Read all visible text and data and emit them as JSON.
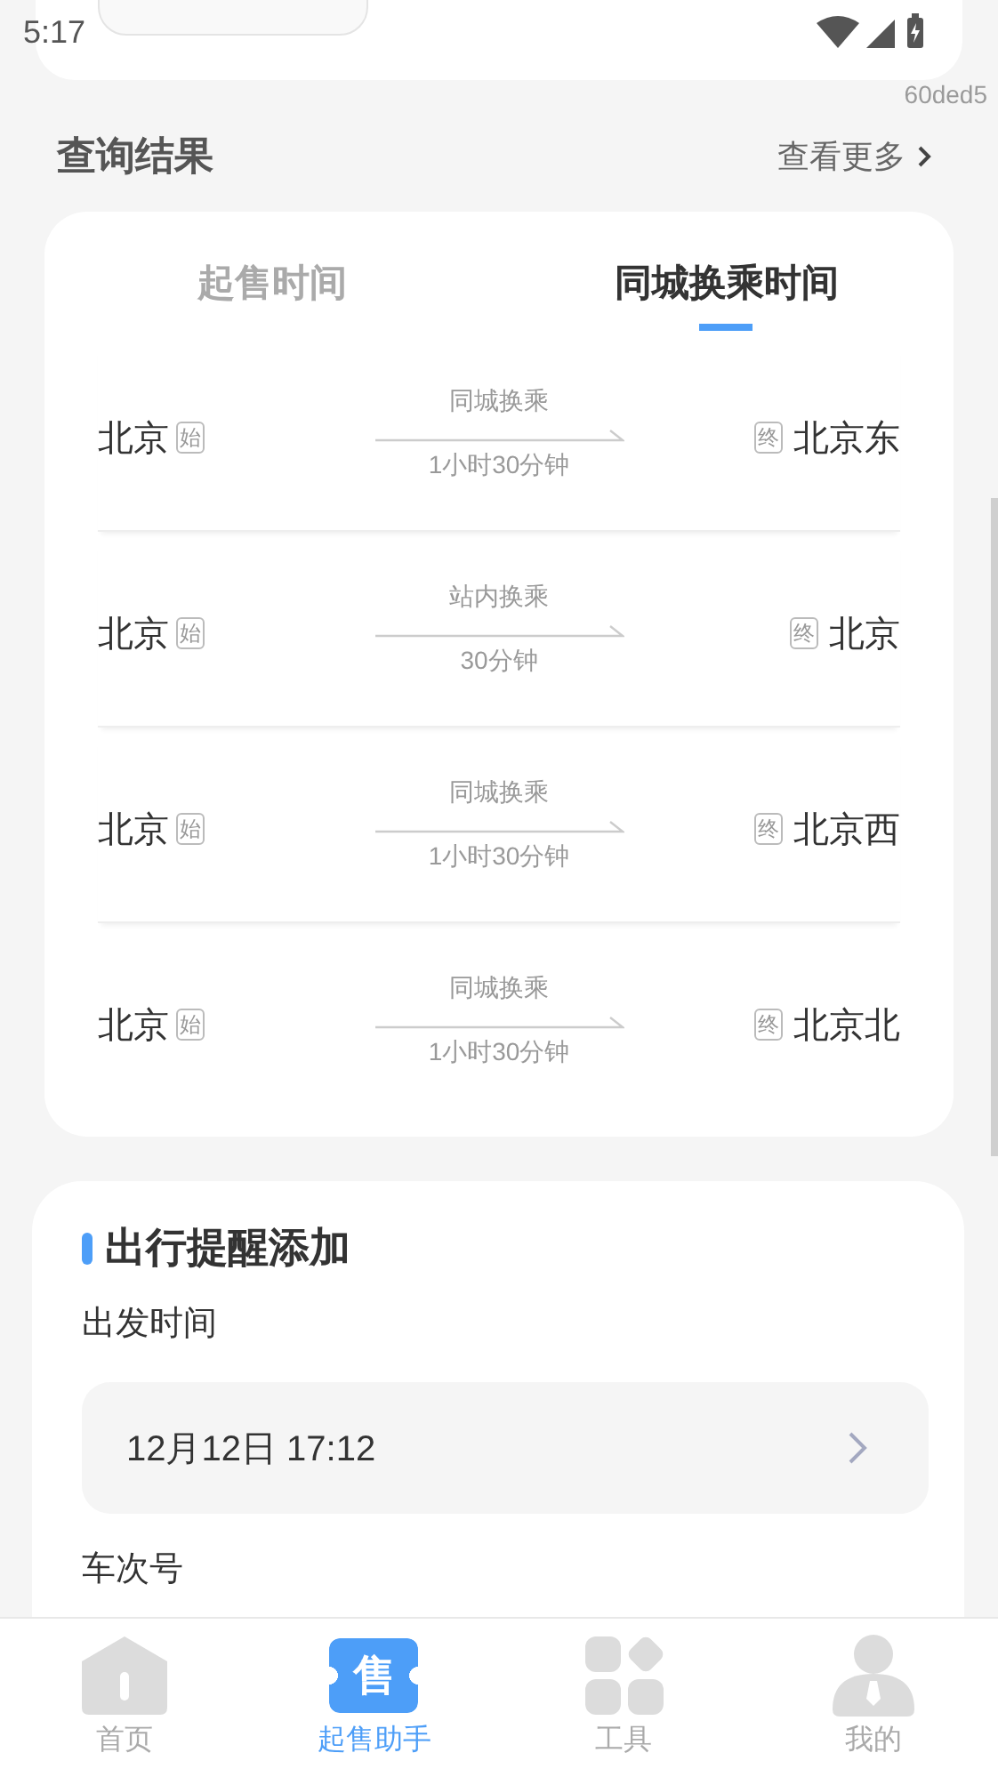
{
  "status_bar": {
    "time": "5:17"
  },
  "build_tag": "60ded5",
  "results": {
    "title": "查询结果",
    "more": "查看更多",
    "tabs": [
      {
        "label": "起售时间",
        "selected": false
      },
      {
        "label": "同城换乘时间",
        "selected": true
      }
    ],
    "routes": [
      {
        "from": "北京",
        "from_tag": "始",
        "transfer": "同城换乘",
        "duration": "1小时30分钟",
        "to_tag": "终",
        "to": "北京东"
      },
      {
        "from": "北京",
        "from_tag": "始",
        "transfer": "站内换乘",
        "duration": "30分钟",
        "to_tag": "终",
        "to": "北京"
      },
      {
        "from": "北京",
        "from_tag": "始",
        "transfer": "同城换乘",
        "duration": "1小时30分钟",
        "to_tag": "终",
        "to": "北京西"
      },
      {
        "from": "北京",
        "from_tag": "始",
        "transfer": "同城换乘",
        "duration": "1小时30分钟",
        "to_tag": "终",
        "to": "北京北"
      }
    ]
  },
  "reminder": {
    "title": "出行提醒添加",
    "fields": [
      {
        "label": "出发时间",
        "value": "12月12日 17:12"
      }
    ],
    "next_label": "车次号"
  },
  "nav": [
    {
      "label": "首页",
      "kind": "home",
      "selected": false
    },
    {
      "label": "起售助手",
      "kind": "ticket",
      "badge": "售",
      "selected": true
    },
    {
      "label": "工具",
      "kind": "grid",
      "selected": false
    },
    {
      "label": "我的",
      "kind": "person",
      "selected": false
    }
  ]
}
